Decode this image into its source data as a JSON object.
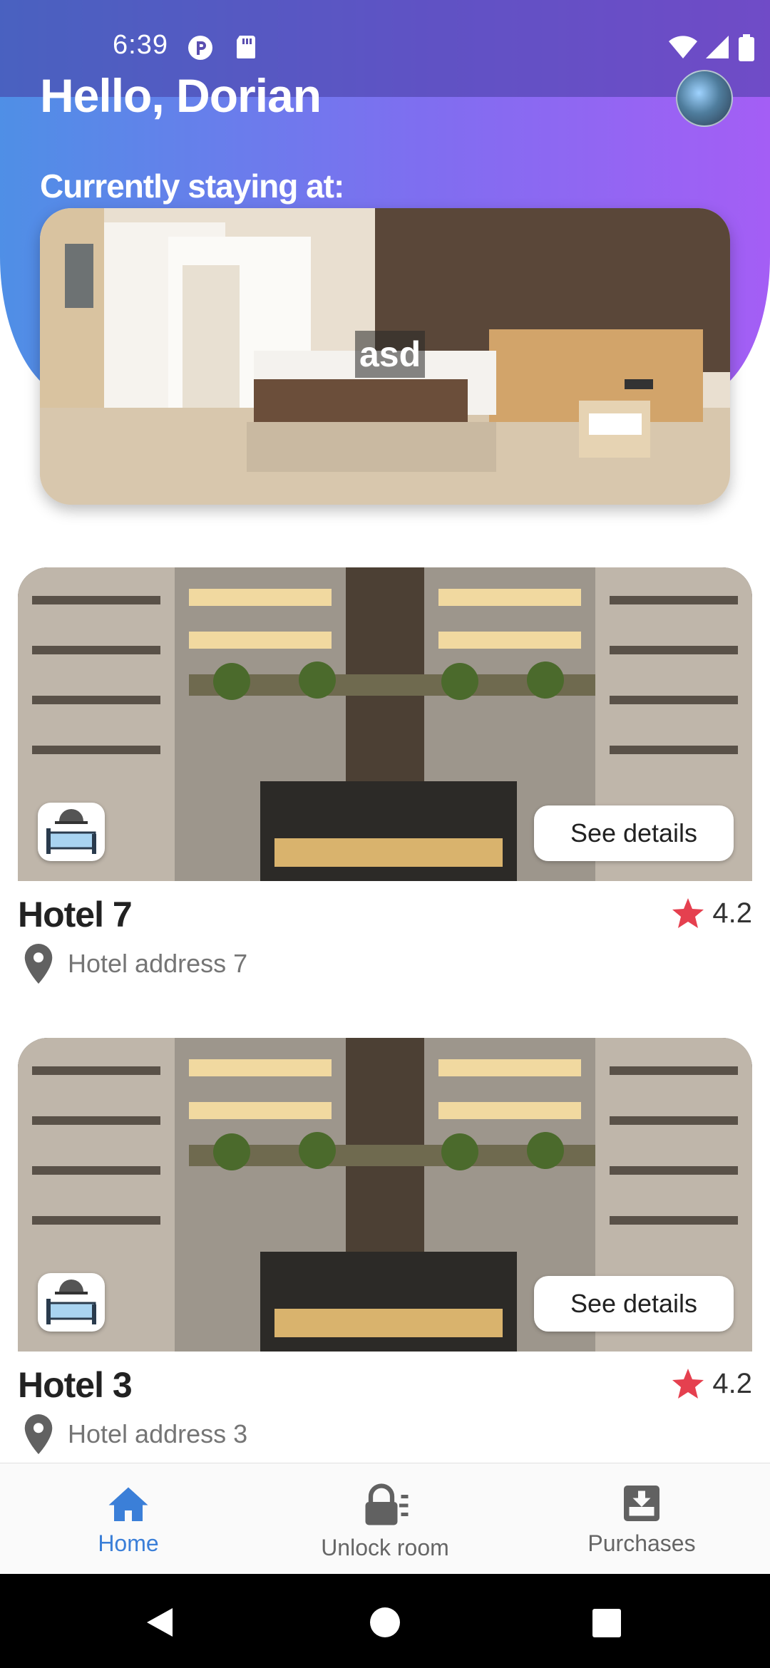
{
  "status_bar": {
    "time": "6:39"
  },
  "header": {
    "greeting": "Hello, Dorian",
    "currently_staying_label": "Currently staying at:",
    "current_hotel_name": "asd"
  },
  "hotels": [
    {
      "name": "Hotel 7",
      "address": "Hotel address 7",
      "rating": "4.2",
      "details_label": "See details"
    },
    {
      "name": "Hotel 3",
      "address": "Hotel address 3",
      "rating": "4.2",
      "details_label": "See details"
    }
  ],
  "bottom_nav": {
    "items": [
      {
        "label": "Home",
        "icon": "home-icon",
        "active": true
      },
      {
        "label": "Unlock room",
        "icon": "lock-icon",
        "active": false
      },
      {
        "label": "Purchases",
        "icon": "purchases-icon",
        "active": false
      }
    ]
  },
  "colors": {
    "accent": "#3b7fd8",
    "gradient_start": "#4f8fe6",
    "gradient_end": "#a45ef5",
    "star": "#e5404f"
  }
}
